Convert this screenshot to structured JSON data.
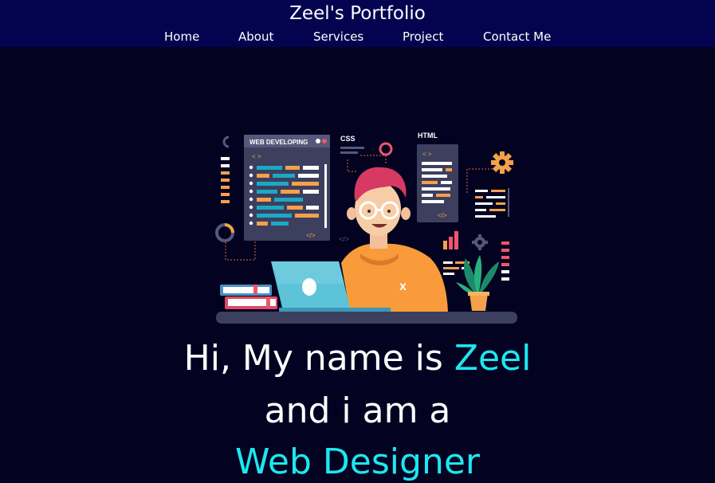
{
  "header": {
    "title": "Zeel's Portfolio",
    "nav": {
      "home": "Home",
      "about": "About",
      "services": "Services",
      "project": "Project",
      "contact": "Contact Me"
    }
  },
  "illustration": {
    "panel_web": "WEB DEVELOPING",
    "code_tag_open": "< >",
    "code_tag_close": "</>",
    "label_css": "CSS",
    "label_html": "HTML",
    "laptop_logo": "x"
  },
  "hero": {
    "line1_prefix": "Hi, My name is ",
    "line1_name": "Zeel",
    "line2": "and i am a",
    "line3_role": "Web Designer"
  },
  "colors": {
    "background": "#030321",
    "navbar": "#03034f",
    "accent": "#1de7f0",
    "text": "#ffffff"
  }
}
